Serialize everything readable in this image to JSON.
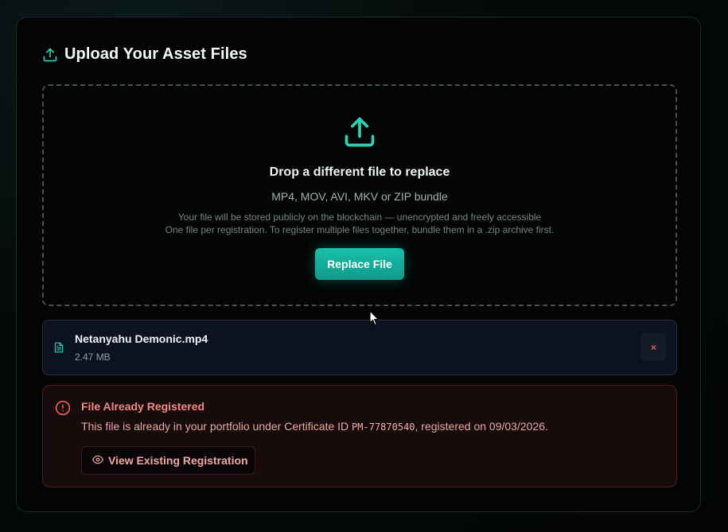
{
  "header": {
    "title": "Upload Your Asset Files",
    "icon": "upload-icon"
  },
  "dropzone": {
    "icon": "upload-icon",
    "title": "Drop a different file to replace",
    "formats": "MP4, MOV, AVI, MKV or ZIP bundle",
    "note_line1": "Your file will be stored publicly on the blockchain — unencrypted and freely accessible",
    "note_line2": "One file per registration. To register multiple files together, bundle them in a .zip archive first.",
    "button_label": "Replace File"
  },
  "file": {
    "icon": "file-text-icon",
    "name": "Netanyahu Demonic.mp4",
    "size": "2.47 MB",
    "remove_label": "×"
  },
  "error": {
    "icon": "alert-circle-icon",
    "title": "File Already Registered",
    "message_prefix": "This file is already in your portfolio under Certificate ID ",
    "certificate_id": "PM-77870540",
    "message_suffix": ", registered on 09/03/2026.",
    "button_icon": "eye-icon",
    "button_label": "View Existing Registration"
  },
  "colors": {
    "accent": "#1abc9c",
    "error": "#f38a85",
    "background": "#030505"
  }
}
